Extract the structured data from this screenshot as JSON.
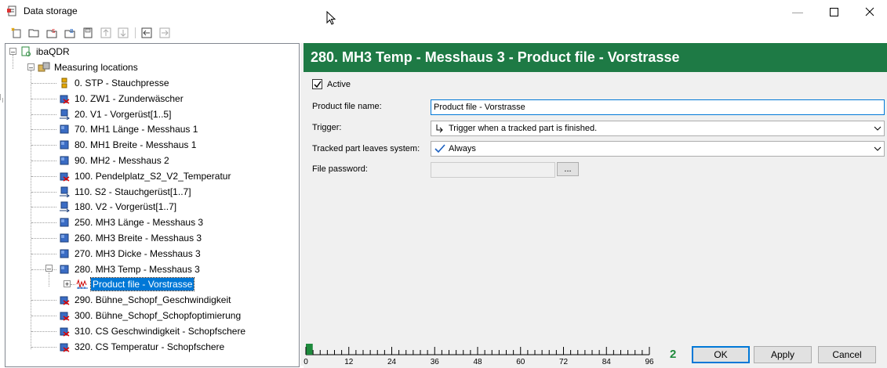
{
  "window": {
    "title": "Data storage"
  },
  "tree": {
    "root": "ibaQDR",
    "group": "Measuring locations",
    "items": [
      {
        "label": "0. STP - Stauchpresse",
        "icon": "stp-icon"
      },
      {
        "label": "10. ZW1 - Zunderwäscher",
        "icon": "disabled-location-icon"
      },
      {
        "label": "20. V1 - Vorgerüst[1..5]",
        "icon": "stand-location-icon"
      },
      {
        "label": "70. MH1 Länge - Messhaus 1",
        "icon": "location-icon"
      },
      {
        "label": "80. MH1 Breite - Messhaus 1",
        "icon": "location-icon"
      },
      {
        "label": "90. MH2 - Messhaus 2",
        "icon": "location-icon"
      },
      {
        "label": "100. Pendelplatz_S2_V2_Temperatur",
        "icon": "disabled-location-icon"
      },
      {
        "label": "110. S2 - Stauchgerüst[1..7]",
        "icon": "stand-location-icon"
      },
      {
        "label": "180. V2 - Vorgerüst[1..7]",
        "icon": "stand-location-icon"
      },
      {
        "label": "250. MH3 Länge - Messhaus 3",
        "icon": "location-icon"
      },
      {
        "label": "260. MH3 Breite - Messhaus 3",
        "icon": "location-icon"
      },
      {
        "label": "270. MH3 Dicke - Messhaus 3",
        "icon": "location-icon"
      },
      {
        "label": "280. MH3 Temp - Messhaus 3",
        "icon": "location-icon"
      },
      {
        "label": "Product file - Vorstrasse",
        "icon": "product-file-icon",
        "selected": true,
        "child": true
      },
      {
        "label": "290. Bühne_Schopf_Geschwindigkeit",
        "icon": "disabled-location-icon"
      },
      {
        "label": "300. Bühne_Schopf_Schopfoptimierung",
        "icon": "disabled-location-icon"
      },
      {
        "label": "310. CS Geschwindigkeit - Schopfschere",
        "icon": "disabled-location-icon"
      },
      {
        "label": "320. CS Temperatur - Schopfschere",
        "icon": "disabled-location-icon"
      }
    ]
  },
  "panel": {
    "header": "280. MH3 Temp - Messhaus 3 - Product file - Vorstrasse",
    "active_label": "Active",
    "active_checked": true,
    "product_file_name_label": "Product file name:",
    "product_file_name_value": "Product file - Vorstrasse",
    "trigger_label": "Trigger:",
    "trigger_value": "Trigger when a tracked part is finished.",
    "tracked_label": "Tracked part leaves system:",
    "tracked_value": "Always",
    "password_label": "File password:",
    "password_value": "",
    "browse_label": "..."
  },
  "footer": {
    "ruler_ticks": [
      "0",
      "12",
      "24",
      "36",
      "48",
      "60",
      "72",
      "84",
      "96"
    ],
    "ruler_fill_fraction": 0.02,
    "count": "2",
    "ok_label": "OK",
    "apply_label": "Apply",
    "cancel_label": "Cancel"
  },
  "colors": {
    "header_bg": "#1e7a45",
    "selection": "#0078d7",
    "count": "#1e8a3c"
  }
}
